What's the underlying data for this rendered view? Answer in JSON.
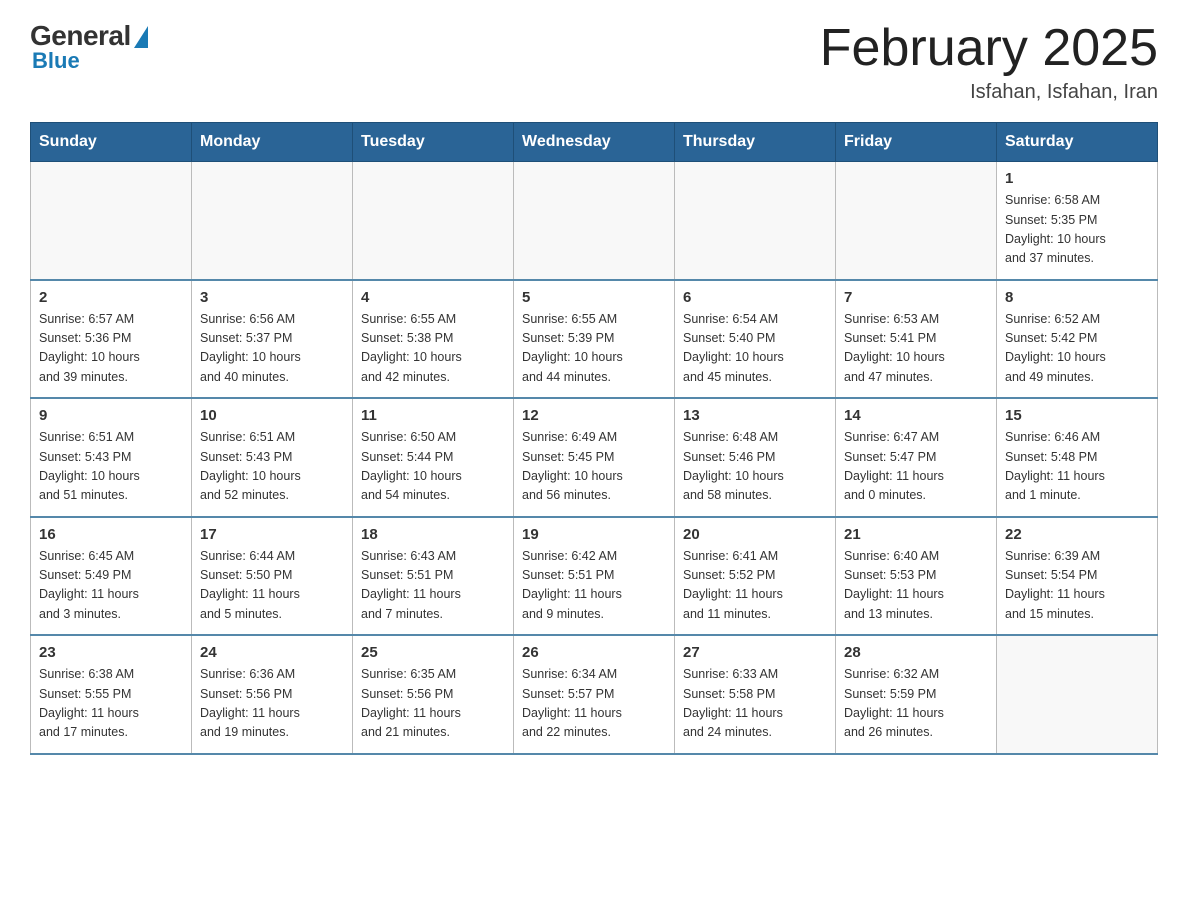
{
  "header": {
    "logo": {
      "general": "General",
      "blue": "Blue"
    },
    "title": "February 2025",
    "location": "Isfahan, Isfahan, Iran"
  },
  "weekdays": [
    "Sunday",
    "Monday",
    "Tuesday",
    "Wednesday",
    "Thursday",
    "Friday",
    "Saturday"
  ],
  "weeks": [
    [
      {
        "day": "",
        "info": ""
      },
      {
        "day": "",
        "info": ""
      },
      {
        "day": "",
        "info": ""
      },
      {
        "day": "",
        "info": ""
      },
      {
        "day": "",
        "info": ""
      },
      {
        "day": "",
        "info": ""
      },
      {
        "day": "1",
        "info": "Sunrise: 6:58 AM\nSunset: 5:35 PM\nDaylight: 10 hours\nand 37 minutes."
      }
    ],
    [
      {
        "day": "2",
        "info": "Sunrise: 6:57 AM\nSunset: 5:36 PM\nDaylight: 10 hours\nand 39 minutes."
      },
      {
        "day": "3",
        "info": "Sunrise: 6:56 AM\nSunset: 5:37 PM\nDaylight: 10 hours\nand 40 minutes."
      },
      {
        "day": "4",
        "info": "Sunrise: 6:55 AM\nSunset: 5:38 PM\nDaylight: 10 hours\nand 42 minutes."
      },
      {
        "day": "5",
        "info": "Sunrise: 6:55 AM\nSunset: 5:39 PM\nDaylight: 10 hours\nand 44 minutes."
      },
      {
        "day": "6",
        "info": "Sunrise: 6:54 AM\nSunset: 5:40 PM\nDaylight: 10 hours\nand 45 minutes."
      },
      {
        "day": "7",
        "info": "Sunrise: 6:53 AM\nSunset: 5:41 PM\nDaylight: 10 hours\nand 47 minutes."
      },
      {
        "day": "8",
        "info": "Sunrise: 6:52 AM\nSunset: 5:42 PM\nDaylight: 10 hours\nand 49 minutes."
      }
    ],
    [
      {
        "day": "9",
        "info": "Sunrise: 6:51 AM\nSunset: 5:43 PM\nDaylight: 10 hours\nand 51 minutes."
      },
      {
        "day": "10",
        "info": "Sunrise: 6:51 AM\nSunset: 5:43 PM\nDaylight: 10 hours\nand 52 minutes."
      },
      {
        "day": "11",
        "info": "Sunrise: 6:50 AM\nSunset: 5:44 PM\nDaylight: 10 hours\nand 54 minutes."
      },
      {
        "day": "12",
        "info": "Sunrise: 6:49 AM\nSunset: 5:45 PM\nDaylight: 10 hours\nand 56 minutes."
      },
      {
        "day": "13",
        "info": "Sunrise: 6:48 AM\nSunset: 5:46 PM\nDaylight: 10 hours\nand 58 minutes."
      },
      {
        "day": "14",
        "info": "Sunrise: 6:47 AM\nSunset: 5:47 PM\nDaylight: 11 hours\nand 0 minutes."
      },
      {
        "day": "15",
        "info": "Sunrise: 6:46 AM\nSunset: 5:48 PM\nDaylight: 11 hours\nand 1 minute."
      }
    ],
    [
      {
        "day": "16",
        "info": "Sunrise: 6:45 AM\nSunset: 5:49 PM\nDaylight: 11 hours\nand 3 minutes."
      },
      {
        "day": "17",
        "info": "Sunrise: 6:44 AM\nSunset: 5:50 PM\nDaylight: 11 hours\nand 5 minutes."
      },
      {
        "day": "18",
        "info": "Sunrise: 6:43 AM\nSunset: 5:51 PM\nDaylight: 11 hours\nand 7 minutes."
      },
      {
        "day": "19",
        "info": "Sunrise: 6:42 AM\nSunset: 5:51 PM\nDaylight: 11 hours\nand 9 minutes."
      },
      {
        "day": "20",
        "info": "Sunrise: 6:41 AM\nSunset: 5:52 PM\nDaylight: 11 hours\nand 11 minutes."
      },
      {
        "day": "21",
        "info": "Sunrise: 6:40 AM\nSunset: 5:53 PM\nDaylight: 11 hours\nand 13 minutes."
      },
      {
        "day": "22",
        "info": "Sunrise: 6:39 AM\nSunset: 5:54 PM\nDaylight: 11 hours\nand 15 minutes."
      }
    ],
    [
      {
        "day": "23",
        "info": "Sunrise: 6:38 AM\nSunset: 5:55 PM\nDaylight: 11 hours\nand 17 minutes."
      },
      {
        "day": "24",
        "info": "Sunrise: 6:36 AM\nSunset: 5:56 PM\nDaylight: 11 hours\nand 19 minutes."
      },
      {
        "day": "25",
        "info": "Sunrise: 6:35 AM\nSunset: 5:56 PM\nDaylight: 11 hours\nand 21 minutes."
      },
      {
        "day": "26",
        "info": "Sunrise: 6:34 AM\nSunset: 5:57 PM\nDaylight: 11 hours\nand 22 minutes."
      },
      {
        "day": "27",
        "info": "Sunrise: 6:33 AM\nSunset: 5:58 PM\nDaylight: 11 hours\nand 24 minutes."
      },
      {
        "day": "28",
        "info": "Sunrise: 6:32 AM\nSunset: 5:59 PM\nDaylight: 11 hours\nand 26 minutes."
      },
      {
        "day": "",
        "info": ""
      }
    ]
  ]
}
